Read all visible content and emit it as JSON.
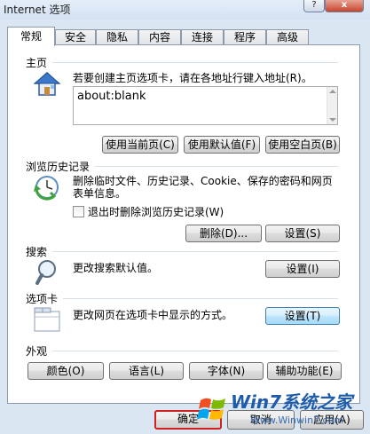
{
  "window": {
    "title": "Internet 选项",
    "help_glyph": "?",
    "close_glyph": "x"
  },
  "tabs": [
    "常规",
    "安全",
    "隐私",
    "内容",
    "连接",
    "程序",
    "高级"
  ],
  "home": {
    "title": "主页",
    "desc": "若要创建主页选项卡，请在各地址行键入地址(R)。",
    "address": "about:blank",
    "use_current": "使用当前页(C)",
    "use_default": "使用默认值(F)",
    "use_blank": "使用空白页(B)"
  },
  "history": {
    "title": "浏览历史记录",
    "desc": "删除临时文件、历史记录、Cookie、保存的密码和网页表单信息。",
    "checkbox": "退出时删除浏览历史记录(W)",
    "delete": "删除(D)...",
    "settings": "设置(S)"
  },
  "search": {
    "title": "搜索",
    "desc": "更改搜索默认值。",
    "settings": "设置(I)"
  },
  "tabs_group": {
    "title": "选项卡",
    "desc": "更改网页在选项卡中显示的方式。",
    "settings": "设置(T)"
  },
  "appearance": {
    "title": "外观",
    "colors": "颜色(O)",
    "languages": "语言(L)",
    "fonts": "字体(N)",
    "accessibility": "辅助功能(E)"
  },
  "footer": {
    "ok": "确定",
    "cancel": "取消",
    "apply": "应用(A)"
  },
  "watermark": {
    "brand": "Win7系统之家",
    "url": "Www.Winwin7.com"
  }
}
